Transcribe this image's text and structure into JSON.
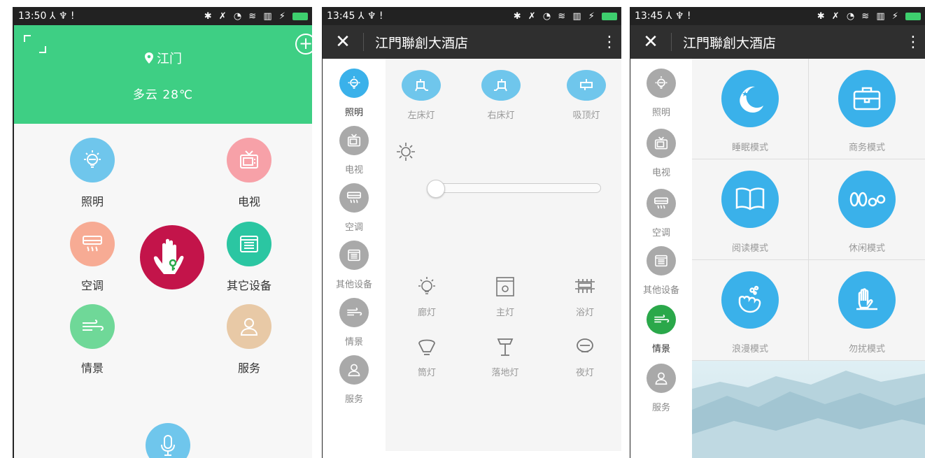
{
  "phone1": {
    "status": {
      "time": "13:50",
      "left_icons": "⅄ ♆ !",
      "right_icons": "✱ ✗ ◔ ≋ ▥ ⚡"
    },
    "city": "江门",
    "weather": "多云   28℃",
    "tiles": {
      "lighting": "照明",
      "tv": "电视",
      "ac": "空调",
      "other": "其它设备",
      "scene": "情景",
      "service": "服务"
    },
    "colors": {
      "header": "#3ecf84",
      "lighting": "#6fc6ec",
      "tv": "#f7a1a8",
      "ac": "#f7ab94",
      "other": "#2bc6a2",
      "scene": "#6fd898",
      "service": "#e8c9a6",
      "hand": "#c3144a",
      "mic": "#6fc6ec"
    }
  },
  "phone2": {
    "status": {
      "time": "13:45",
      "left_icons": "⅄ ♆ !",
      "right_icons": "✱ ✗ ◔ ≋ ▥ ⚡"
    },
    "title": "江門聯創大酒店",
    "sidebar": [
      "照明",
      "电视",
      "空调",
      "其他设备",
      "情景",
      "服务"
    ],
    "lamps_top": [
      "左床灯",
      "右床灯",
      "吸顶灯"
    ],
    "lamps_bottom": [
      "廊灯",
      "主灯",
      "浴灯",
      "筒灯",
      "落地灯",
      "夜灯"
    ],
    "brightness_level": 0.0
  },
  "phone3": {
    "status": {
      "time": "13:45",
      "left_icons": "⅄ ♆ !",
      "right_icons": "✱ ✗ ◔ ≋ ▥ ⚡"
    },
    "title": "江門聯創大酒店",
    "sidebar": [
      "照明",
      "电视",
      "空调",
      "其他设备",
      "情景",
      "服务"
    ],
    "modes": [
      "睡眠模式",
      "商务模式",
      "阅读模式",
      "休闲模式",
      "浪漫模式",
      "勿扰模式"
    ],
    "active_color": "#2aa84a"
  }
}
